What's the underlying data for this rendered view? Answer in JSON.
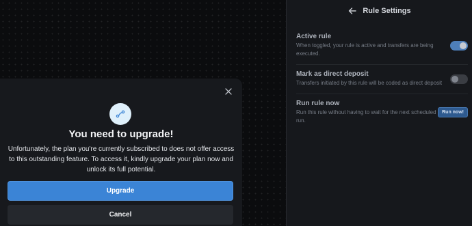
{
  "settings": {
    "title": "Rule Settings",
    "back_icon": "arrow-left-icon",
    "rules": [
      {
        "title": "Active rule",
        "description": "When toggled, your rule is active and transfers are being executed.",
        "control": "toggle",
        "state": "on"
      },
      {
        "title": "Mark as direct deposit",
        "description": "Transfers initiated by this rule will be coded as direct deposit",
        "control": "toggle",
        "state": "off"
      },
      {
        "title": "Run rule now",
        "description": "Run this rule without having to wait for the next scheduled run.",
        "control": "button",
        "button_label": "Run now!"
      }
    ]
  },
  "modal": {
    "icon": "route-icon",
    "close_icon": "close-icon",
    "title": "You need to upgrade!",
    "body": "Unfortunately, the plan you're currently subscribed to does not offer access to this outstanding feature. To access it, kindly upgrade your plan now and unlock its full potential.",
    "primary_label": "Upgrade",
    "secondary_label": "Cancel"
  },
  "colors": {
    "accent": "#3b84d6",
    "toggle_on": "#4e7fb9",
    "background": "#0a0b0d",
    "panel": "#16181c",
    "modal": "#17191d"
  }
}
